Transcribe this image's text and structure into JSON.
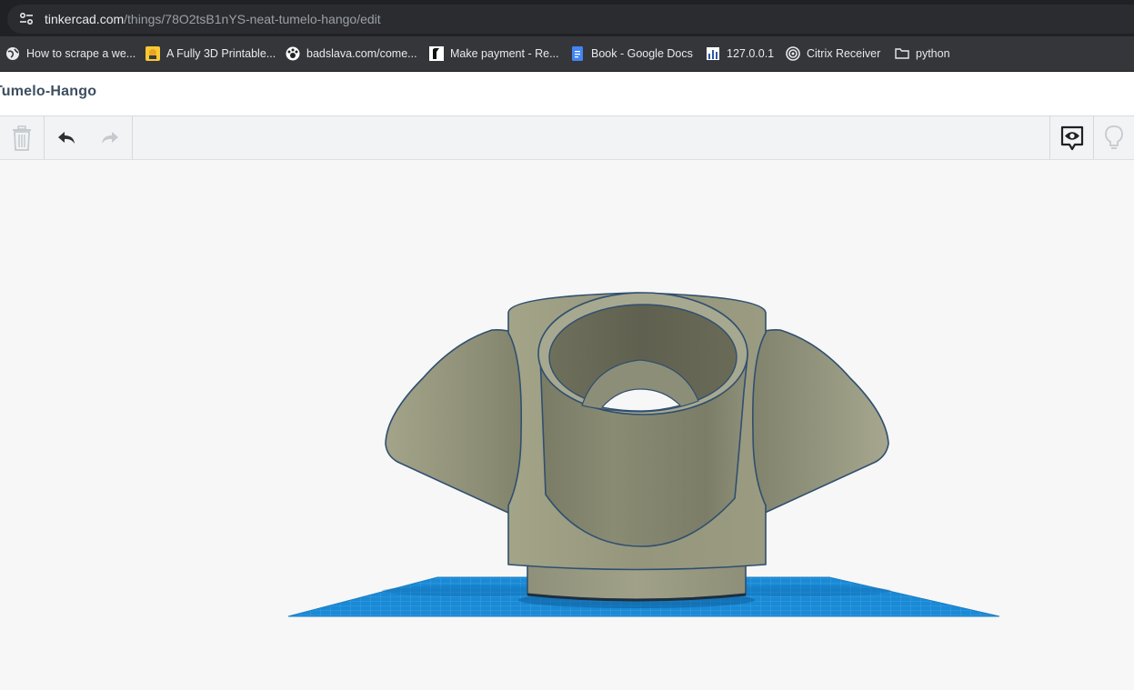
{
  "browser": {
    "url_host": "tinkercad.com",
    "url_path": "/things/78O2tsB1nYS-neat-tumelo-hango/edit",
    "site_info_icon": "tune-icon"
  },
  "bookmarks": [
    {
      "label": "How to scrape a we...",
      "icon": "globe-icon"
    },
    {
      "label": "A Fully 3D Printable...",
      "icon": "instructables-icon"
    },
    {
      "label": "badslava.com/come...",
      "icon": "paw-icon"
    },
    {
      "label": "Make payment - Re...",
      "icon": "receipt-icon"
    },
    {
      "label": "Book - Google Docs",
      "icon": "google-docs-icon"
    },
    {
      "label": "127.0.0.1",
      "icon": "bar-chart-icon"
    },
    {
      "label": "Citrix Receiver",
      "icon": "citrix-icon"
    },
    {
      "label": "python",
      "icon": "folder-icon"
    }
  ],
  "design": {
    "title": "Tumelo-Hango"
  },
  "toolbar": {
    "delete_icon": "trash-icon",
    "undo_icon": "undo-icon",
    "redo_icon": "redo-icon",
    "view_icon": "eye-speech-icon",
    "hint_icon": "lightbulb-icon"
  },
  "colors": {
    "model_fill": "#a5a68c",
    "model_outline": "#2f4f6f",
    "workplane": "#1d8fd8",
    "grid_line": "#5fb3ea"
  }
}
